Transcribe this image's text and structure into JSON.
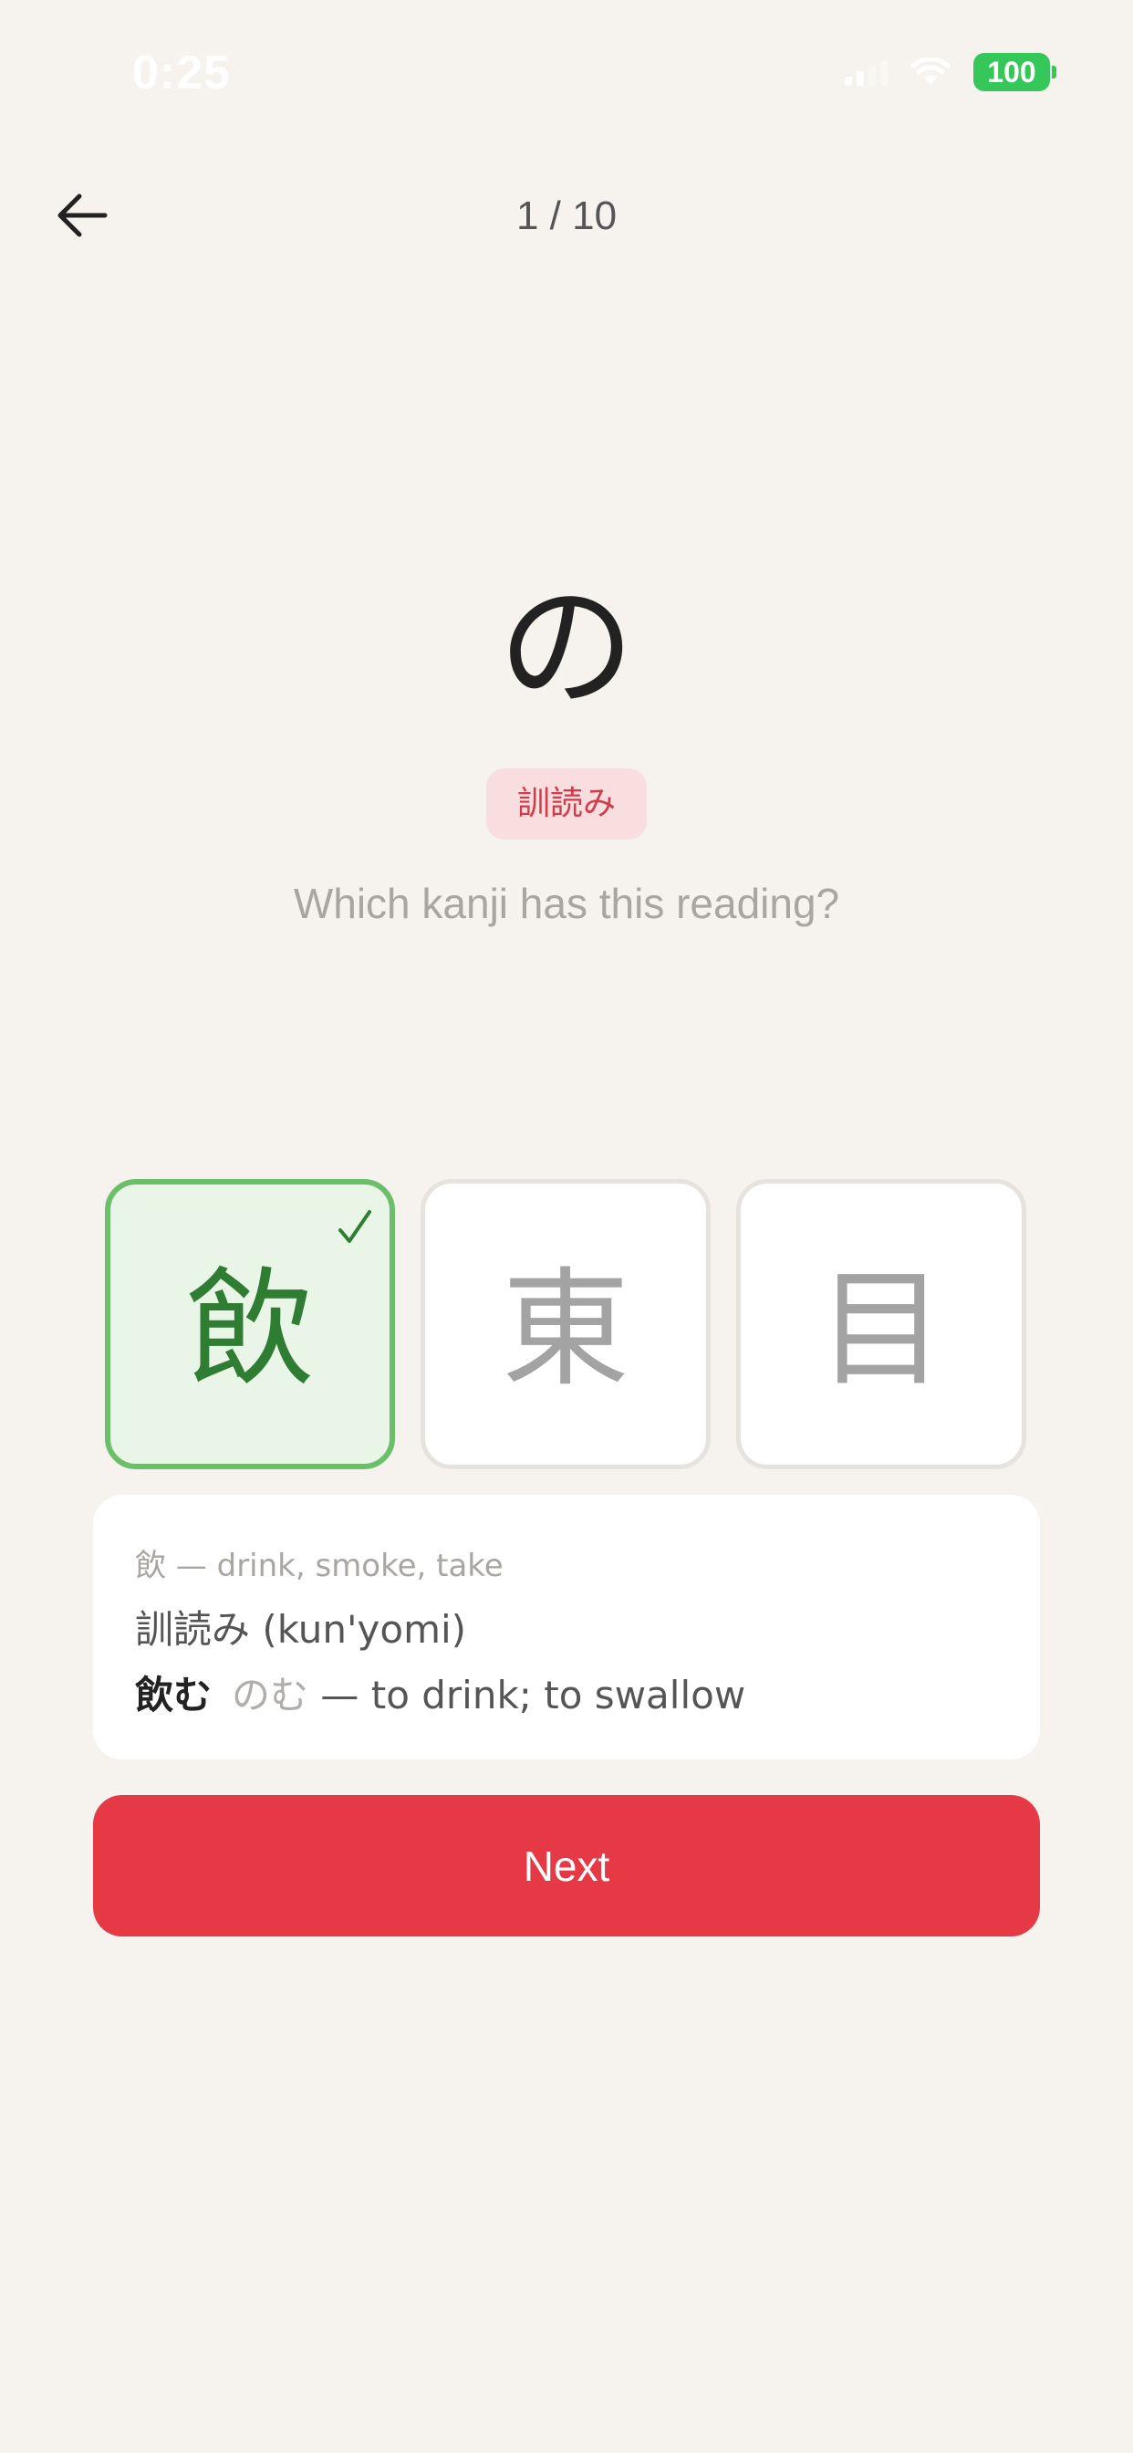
{
  "status_bar": {
    "time": "0:25",
    "battery": "100"
  },
  "header": {
    "progress": "1 / 10"
  },
  "prompt": {
    "reading": "の",
    "reading_type_badge": "訓読み",
    "question": "Which kanji has this reading?"
  },
  "choices": [
    {
      "kanji": "飲",
      "state": "correct"
    },
    {
      "kanji": "東",
      "state": "default"
    },
    {
      "kanji": "目",
      "state": "default"
    }
  ],
  "info": {
    "meaning": "飲 — drink, smoke, take",
    "reading_type": "訓読み (kun'yomi)",
    "example_word": "飲む",
    "example_kana": "のむ",
    "example_gloss": "— to drink; to swallow"
  },
  "actions": {
    "next_label": "Next"
  },
  "colors": {
    "background": "#f6f3ef",
    "accent": "#e63946",
    "correct_border": "#6cbf6a",
    "correct_bg": "#e8f5e7",
    "correct_text": "#2e7d32",
    "badge_bg": "#f8dede",
    "badge_text": "#d23b4a",
    "battery": "#35c759"
  }
}
